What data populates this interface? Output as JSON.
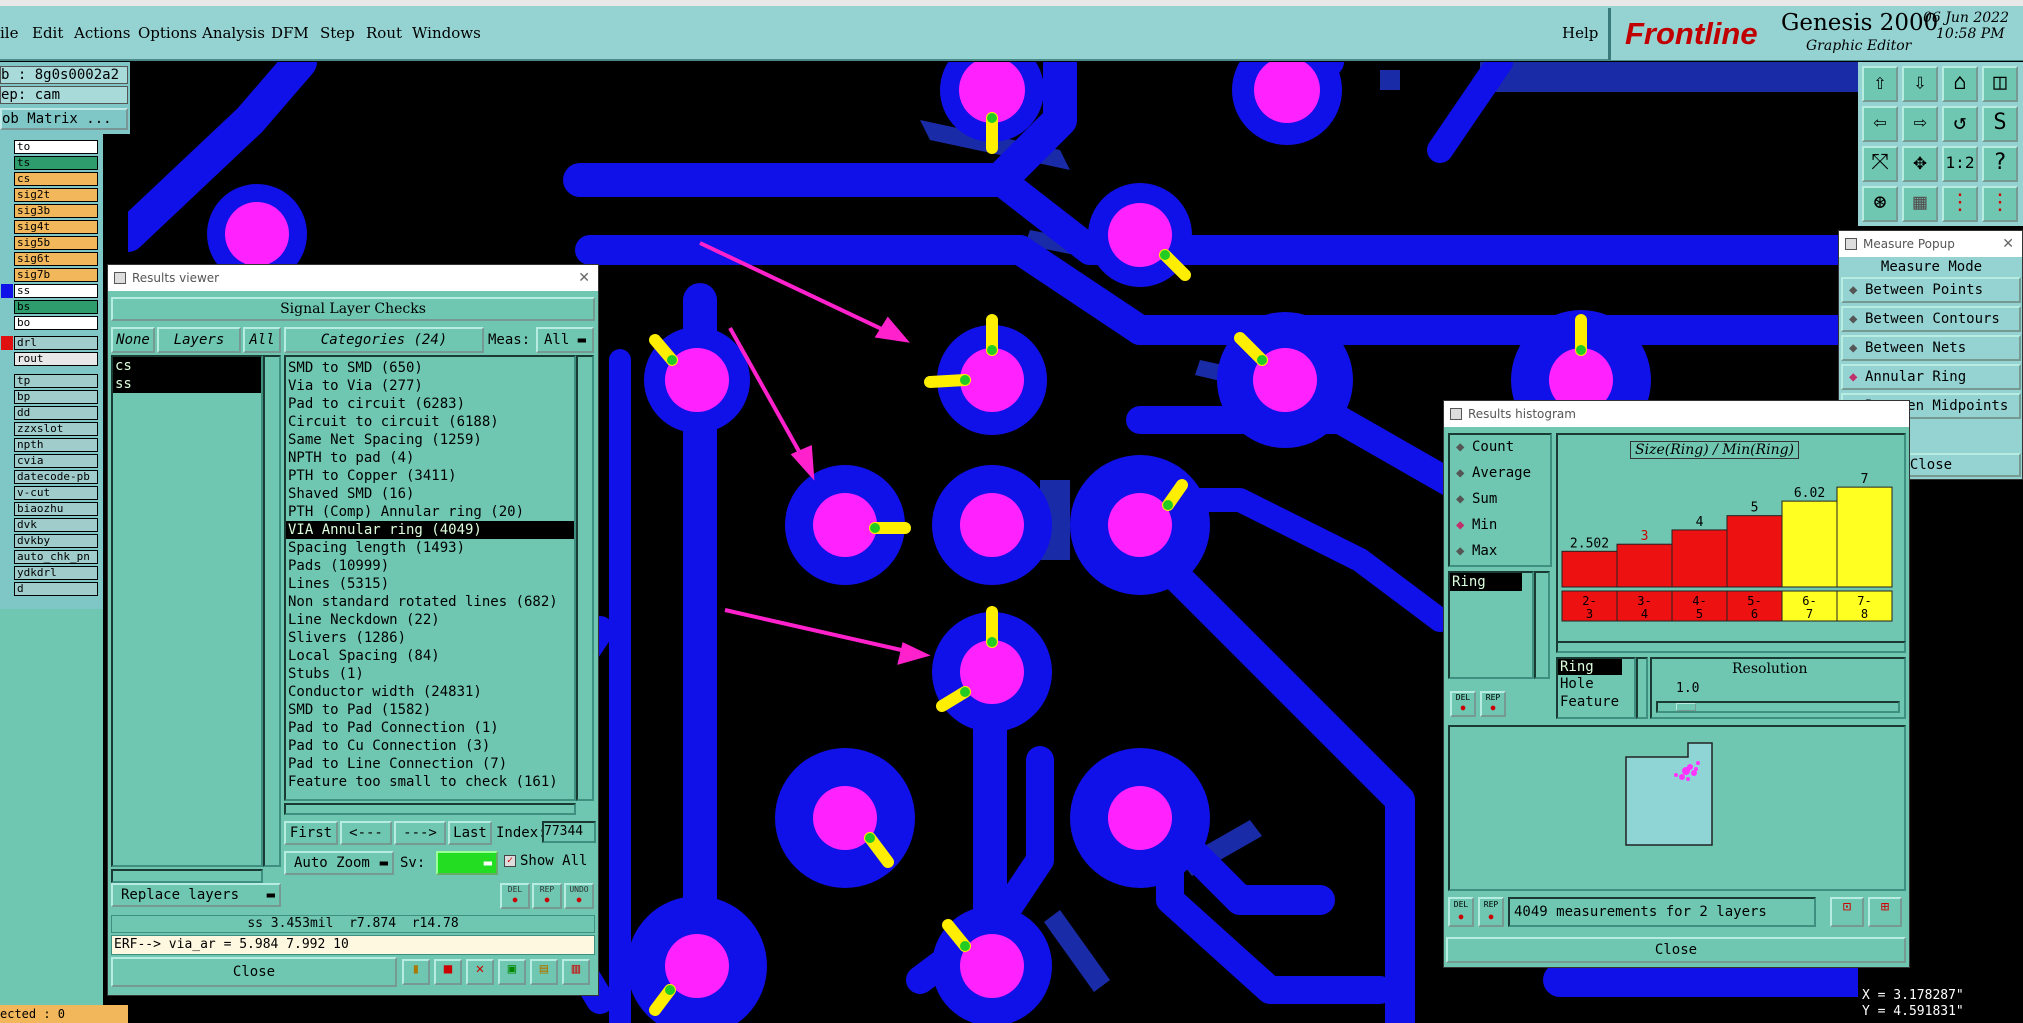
{
  "menubar": {
    "items": [
      "ile",
      "Edit",
      "Actions",
      "Options",
      "Analysis",
      "DFM",
      "Step",
      "Rout",
      "Windows"
    ],
    "help": "Help"
  },
  "brand": {
    "logo": "Frontline",
    "product": "Genesis 2000",
    "subtitle": "Graphic Editor",
    "date": "06 Jun 2022",
    "time": "10:58 PM"
  },
  "left_panel": {
    "job": "b : 8g0s0002a2",
    "step": "ep: cam",
    "matrix_button": "ob Matrix ...",
    "layers": [
      {
        "name": "to",
        "color": "#ffffff"
      },
      {
        "name": "ts",
        "color": "#2e9c6c"
      },
      {
        "name": "cs",
        "color": "#f2b75a"
      },
      {
        "name": "sig2t",
        "color": "#f2b75a"
      },
      {
        "name": "sig3b",
        "color": "#f2b75a"
      },
      {
        "name": "sig4t",
        "color": "#f2b75a"
      },
      {
        "name": "sig5b",
        "color": "#f2b75a"
      },
      {
        "name": "sig6t",
        "color": "#f2b75a"
      },
      {
        "name": "sig7b",
        "color": "#f2b75a"
      },
      {
        "name": "ss",
        "color": "#ffffff"
      },
      {
        "name": "bs",
        "color": "#2e9c6c"
      },
      {
        "name": "bo",
        "color": "#ffffff"
      },
      {
        "name": "drl",
        "color": "#a0cccc"
      },
      {
        "name": "rout",
        "color": "#e8e8e8"
      },
      {
        "name": "tp",
        "color": "#a0cccc"
      },
      {
        "name": "bp",
        "color": "#a0cccc"
      },
      {
        "name": "dd",
        "color": "#a0cccc"
      },
      {
        "name": "zzxslot",
        "color": "#a0cccc"
      },
      {
        "name": "npth",
        "color": "#a0cccc"
      },
      {
        "name": "cvia",
        "color": "#a0cccc"
      },
      {
        "name": "datecode-pb",
        "color": "#a0cccc"
      },
      {
        "name": "v-cut",
        "color": "#a0cccc"
      },
      {
        "name": "biaozhu",
        "color": "#a0cccc"
      },
      {
        "name": "dvk",
        "color": "#a0cccc"
      },
      {
        "name": "dvkby",
        "color": "#a0cccc"
      },
      {
        "name": "auto_chk_pn",
        "color": "#a0cccc"
      },
      {
        "name": "ydkdrl",
        "color": "#a0cccc"
      },
      {
        "name": "d",
        "color": "#a0cccc"
      }
    ],
    "selected_status": "ected : 0"
  },
  "results_viewer": {
    "title": "Results viewer",
    "header": "Signal Layer Checks",
    "none": "None",
    "layers": "Layers",
    "all": "All",
    "layer_list": [
      "cs",
      "ss"
    ],
    "categories_label": "Categories (24)",
    "meas_label": "Meas:",
    "meas_value": "All",
    "categories": [
      "SMD to SMD (650)",
      "Via to Via (277)",
      "Pad to circuit (6283)",
      "Circuit to circuit (6188)",
      "Same Net Spacing (1259)",
      "NPTH to pad (4)",
      "PTH to Copper (3411)",
      "Shaved SMD (16)",
      "PTH (Comp) Annular ring (20)",
      "VIA Annular ring (4049)",
      "Spacing length (1493)",
      "Pads (10999)",
      "Lines (5315)",
      "Non standard rotated lines (682)",
      "Line Neckdown (22)",
      "Slivers (1286)",
      "Local Spacing (84)",
      "Stubs (1)",
      "Conductor width (24831)",
      "SMD to Pad (1582)",
      "Pad to Pad Connection (1)",
      "Pad to Cu Connection (3)",
      "Pad to Line Connection (7)",
      "Feature too small to check (161)"
    ],
    "first": "First",
    "prev": "<---",
    "next": "--->",
    "last": "Last",
    "index_label": "Index:",
    "index_value": "77344",
    "autozoom": "Auto Zoom",
    "sv_label": "Sv:",
    "show_all": "Show All",
    "replace_layers": "Replace layers",
    "del": "DEL",
    "rep": "REP",
    "undo": "UNDO",
    "status": "ss 3.453mil  r7.874  r14.78",
    "erf": "ERF--> via_ar = 5.984 7.992 10",
    "close": "Close"
  },
  "measure_popup": {
    "title": "Measure Popup",
    "mode_label": "Measure Mode",
    "modes": [
      "Between Points",
      "Between Contours",
      "Between Nets",
      "Annular Ring",
      "Between Midpoints"
    ],
    "selected_mode": "Annular Ring",
    "close": "Close"
  },
  "results_histogram": {
    "title": "Results histogram",
    "options": [
      "Count",
      "Average",
      "Sum",
      "Min",
      "Max"
    ],
    "selected_option": "Min",
    "list": [
      "Ring"
    ],
    "chart_title": "Size(Ring) / Min(Ring)",
    "resolution_label": "Resolution",
    "resolution_value": "1.0",
    "feature_types": [
      "Ring",
      "Hole",
      "Feature"
    ],
    "summary": "4049 measurements for 2 layers",
    "close": "Close",
    "del": "DEL",
    "rep": "REP"
  },
  "chart_data": {
    "type": "bar",
    "title": "Size(Ring) / Min(Ring)",
    "categories": [
      "2-3",
      "3-4",
      "4-5",
      "5-6",
      "6-7",
      "7-8"
    ],
    "values": [
      2.502,
      3,
      4,
      5,
      6.02,
      7
    ],
    "value_labels": [
      "2.502",
      "3",
      "4",
      "5",
      "6.02",
      "7"
    ],
    "colors": [
      "#ee1111",
      "#ee1111",
      "#ee1111",
      "#ee1111",
      "#ffff22",
      "#ffff22"
    ],
    "label_colors": [
      "#000000",
      "#cc0000",
      "#000000",
      "#000000",
      "#000000",
      "#000000"
    ],
    "ylim": [
      0,
      7.5
    ]
  },
  "coords": {
    "x": "X = 3.178287\"",
    "y": "Y = 4.591831\""
  }
}
